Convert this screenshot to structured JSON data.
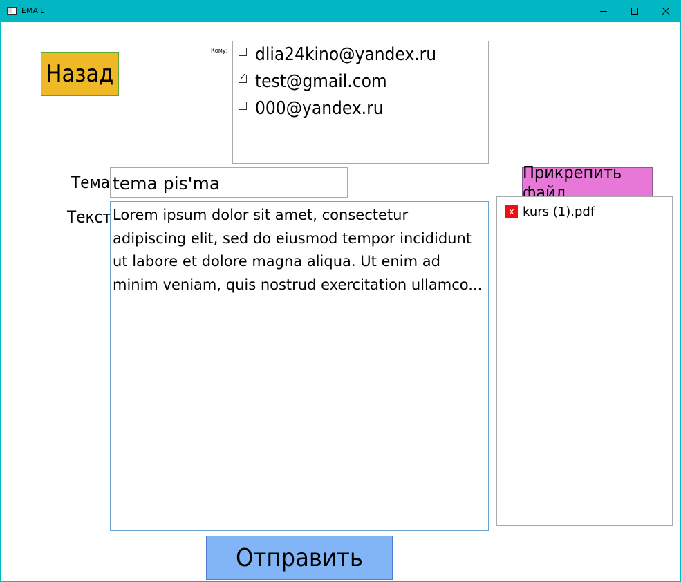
{
  "window": {
    "title": "EMAiL",
    "accent_color": "#00b7c3",
    "controls": [
      "minimize-icon",
      "maximize-icon",
      "close-icon"
    ]
  },
  "back_button": {
    "label": "Назад",
    "color": "#eeb826"
  },
  "recipients": {
    "label": "Кому:",
    "items": [
      {
        "email": "dlia24kino@yandex.ru",
        "checked": false
      },
      {
        "email": "test@gmail.com",
        "checked": true
      },
      {
        "email": "000@yandex.ru",
        "checked": false
      }
    ]
  },
  "subject": {
    "label": "Тема:",
    "value": "tema pis'ma"
  },
  "body": {
    "label": "Текст:",
    "value": "Lorem ipsum dolor sit amet, consectetur adipiscing elit, sed do eiusmod tempor incididunt ut labore et dolore magna aliqua. Ut enim ad minim veniam, quis nostrud exercitation ullamco..."
  },
  "attach_button": {
    "label": "Прикрепить файл",
    "color": "#e878d8"
  },
  "attachments": [
    {
      "remove_label": "x",
      "name": "kurs (1).pdf"
    }
  ],
  "send_button": {
    "label": "Отправить",
    "color": "#82b5f5"
  }
}
